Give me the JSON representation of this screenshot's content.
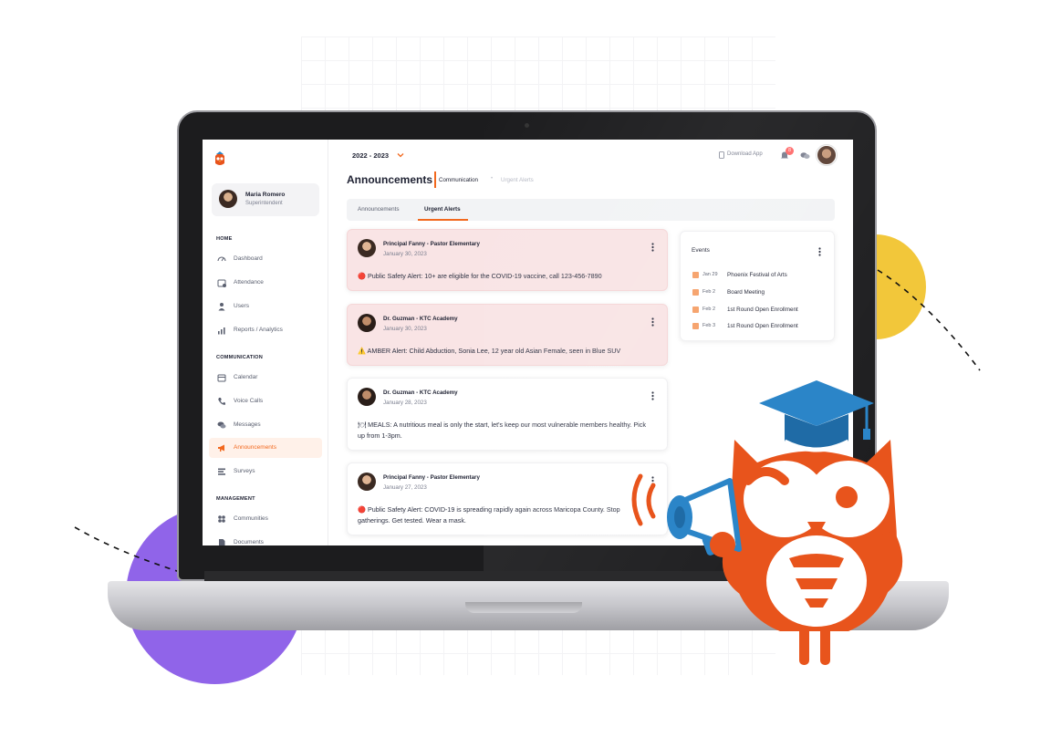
{
  "app": {
    "school_year": "2022 - 2023",
    "download_app": "Download App",
    "notification_count": "8"
  },
  "profile": {
    "name": "Maria Romero",
    "role": "Superintendent"
  },
  "sidebar": {
    "sections": [
      {
        "title": "HOME",
        "items": [
          {
            "label": "Dashboard",
            "icon": "dashboard-icon"
          },
          {
            "label": "Attendance",
            "icon": "attendance-icon"
          },
          {
            "label": "Users",
            "icon": "users-icon"
          },
          {
            "label": "Reports / Analytics",
            "icon": "analytics-icon"
          }
        ]
      },
      {
        "title": "COMMUNICATION",
        "items": [
          {
            "label": "Calendar",
            "icon": "calendar-icon"
          },
          {
            "label": "Voice Calls",
            "icon": "phone-icon"
          },
          {
            "label": "Messages",
            "icon": "messages-icon"
          },
          {
            "label": "Announcements",
            "icon": "megaphone-icon",
            "active": true
          },
          {
            "label": "Surveys",
            "icon": "surveys-icon"
          }
        ]
      },
      {
        "title": "MANAGEMENT",
        "items": [
          {
            "label": "Communities",
            "icon": "communities-icon"
          },
          {
            "label": "Documents",
            "icon": "documents-icon"
          }
        ]
      }
    ]
  },
  "page": {
    "title": "Announcements",
    "breadcrumb": [
      "Communication",
      "Urgent Alerts"
    ],
    "tabs": [
      {
        "label": "Announcements",
        "active": false
      },
      {
        "label": "Urgent Alerts",
        "active": true
      }
    ]
  },
  "announcements": [
    {
      "author": "Principal Fanny - Pastor Elementary",
      "date": "January 30, 2023",
      "text": "🔴 Public Safety Alert: 10+ are eligible for the COVID-19 vaccine, call 123-456-7890",
      "urgent": true
    },
    {
      "author": "Dr. Guzman - KTC Academy",
      "date": "January 30, 2023",
      "text": "⚠️ AMBER Alert: Child Abduction, Sonia Lee, 12 year old Asian Female, seen in Blue SUV",
      "urgent": true
    },
    {
      "author": "Dr. Guzman - KTC Academy",
      "date": "January 28, 2023",
      "text": "🍽 MEALS: A nutritious meal is only the start, let's keep our most vulnerable members healthy. Pick up from 1-3pm.",
      "urgent": false
    },
    {
      "author": "Principal Fanny - Pastor Elementary",
      "date": "January 27, 2023",
      "text": "🔴 Public Safety Alert: COVID-19 is spreading rapidly again across Maricopa County. Stop gatherings. Get tested. Wear a mask.",
      "urgent": false
    }
  ],
  "events": {
    "title": "Events",
    "items": [
      {
        "date": "Jan 29",
        "title": "Phoenix Festival of Arts"
      },
      {
        "date": "Feb 2",
        "title": "Board Meeting"
      },
      {
        "date": "Feb 2",
        "title": "1st Round Open Enrollment"
      },
      {
        "date": "Feb 3",
        "title": "1st Round Open Enrollment"
      }
    ]
  },
  "colors": {
    "accent": "#f2681d",
    "alert_bg": "#f9e4e5",
    "mascot_orange": "#e8541c",
    "mascot_blue": "#2b85c8",
    "purple_blob": "#9064e9",
    "yellow_blob": "#f2c73a"
  }
}
